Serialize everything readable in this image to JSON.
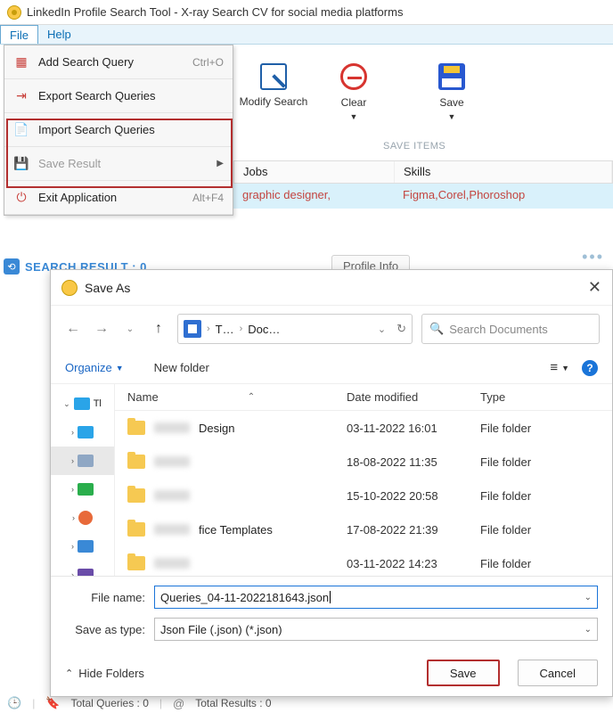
{
  "window": {
    "title": "LinkedIn Profile Search Tool - X-ray Search CV for social media platforms"
  },
  "menubar": {
    "file": "File",
    "help": "Help"
  },
  "fileMenu": {
    "addQuery": "Add Search Query",
    "addQueryShortcut": "Ctrl+O",
    "exportQueries": "Export Search Queries",
    "importQueries": "Import Search Queries",
    "saveResult": "Save Result",
    "exit": "Exit Application",
    "exitShortcut": "Alt+F4"
  },
  "toolbar": {
    "modify": "Modify Search",
    "clear": "Clear",
    "save": "Save",
    "saveItems": "SAVE ITEMS"
  },
  "grid": {
    "headers": {
      "jobs": "Jobs",
      "skills": "Skills"
    },
    "row": {
      "jobs": "graphic designer,",
      "skills": "Figma,Corel,Phoroshop"
    }
  },
  "resultBar": {
    "label": "SEARCH RESULT : 0"
  },
  "profileTab": "Profile Info",
  "dialog": {
    "title": "Save As",
    "nav": {
      "t": "T…",
      "doc": "Doc…"
    },
    "searchPlaceholder": "Search Documents",
    "organize": "Organize",
    "newFolder": "New folder",
    "columns": {
      "name": "Name",
      "date": "Date modified",
      "type": "Type"
    },
    "rows": [
      {
        "suffix": " Design",
        "date": "03-11-2022 16:01",
        "type": "File folder"
      },
      {
        "suffix": "",
        "date": "18-08-2022 11:35",
        "type": "File folder"
      },
      {
        "suffix": "",
        "date": "15-10-2022 20:58",
        "type": "File folder"
      },
      {
        "suffix": "fice Templates",
        "date": "17-08-2022 21:39",
        "type": "File folder"
      },
      {
        "suffix": "",
        "date": "03-11-2022 14:23",
        "type": "File folder"
      }
    ],
    "tree": {
      "root": "Tl"
    },
    "fileNameLabel": "File name:",
    "fileNameValue": "Queries_04-11-2022181643.json",
    "saveTypeLabel": "Save as type:",
    "saveTypeValue": "Json File (.json) (*.json)",
    "hideFolders": "Hide Folders",
    "save": "Save",
    "cancel": "Cancel"
  },
  "status": {
    "totalQueries": "Total Queries : 0",
    "totalResults": "Total Results : 0"
  }
}
